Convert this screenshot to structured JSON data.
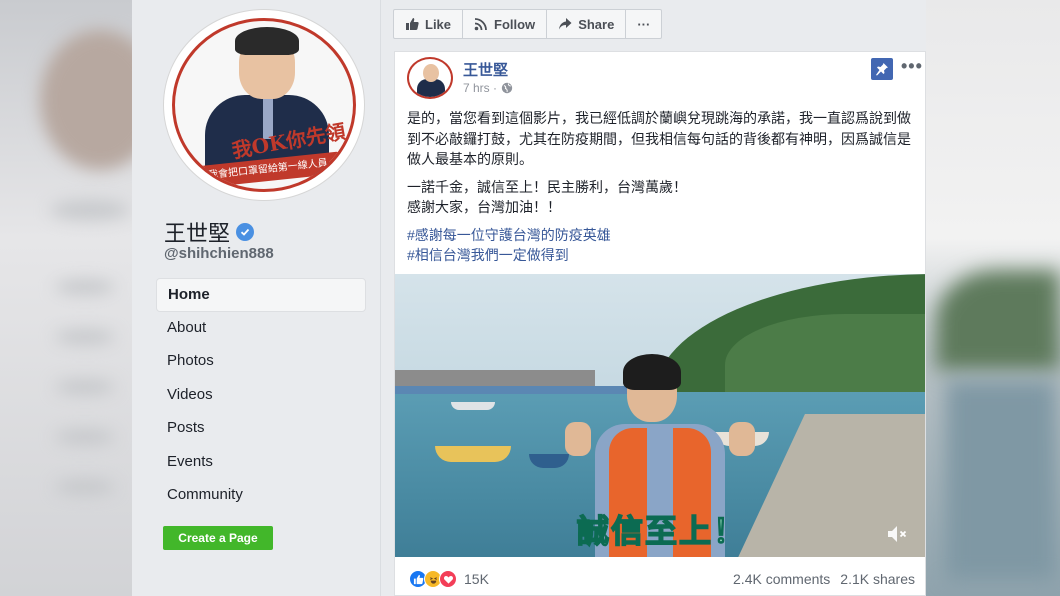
{
  "sidebar": {
    "page_name": "王世堅",
    "handle": "@shihchien888",
    "avatar_text": "我OK你先領",
    "avatar_ribbon": "我會把口罩留給第一線人員",
    "nav": [
      {
        "label": "Home",
        "active": true
      },
      {
        "label": "About"
      },
      {
        "label": "Photos"
      },
      {
        "label": "Videos"
      },
      {
        "label": "Posts"
      },
      {
        "label": "Events"
      },
      {
        "label": "Community"
      }
    ],
    "create_page_label": "Create a Page"
  },
  "actions": {
    "like": "Like",
    "follow": "Follow",
    "share": "Share",
    "more": "···"
  },
  "post": {
    "author": "王世堅",
    "time": "7 hrs ·",
    "more": "•••",
    "paragraph1": "是的，當您看到這個影片，我已經低調於蘭嶼兌現跳海的承諾，我一直認爲說到做到不必敲鑼打鼓，尤其在防疫期間，但我相信每句話的背後都有神明，因爲誠信是做人最基本的原則。",
    "line2": "一諾千金，誠信至上！民主勝利，台灣萬歲！",
    "line3": "感謝大家，台灣加油！！",
    "hashtag1": "#感謝每一位守護台灣的防疫英雄",
    "hashtag2": "#相信台灣我們一定做得到",
    "video_caption": "誠信至上！",
    "reaction_count": "15K",
    "comments": "2.4K comments",
    "shares": "2.1K shares"
  },
  "colors": {
    "link": "#385898",
    "create_button": "#42b72a",
    "verified": "#4a90e2",
    "pin": "#4267b2"
  },
  "icons": [
    "verified-badge-icon",
    "like-thumb-icon",
    "follow-rss-icon",
    "share-arrow-icon",
    "globe-icon",
    "pin-icon",
    "mute-icon",
    "like-reaction-icon",
    "haha-reaction-icon",
    "love-reaction-icon"
  ]
}
